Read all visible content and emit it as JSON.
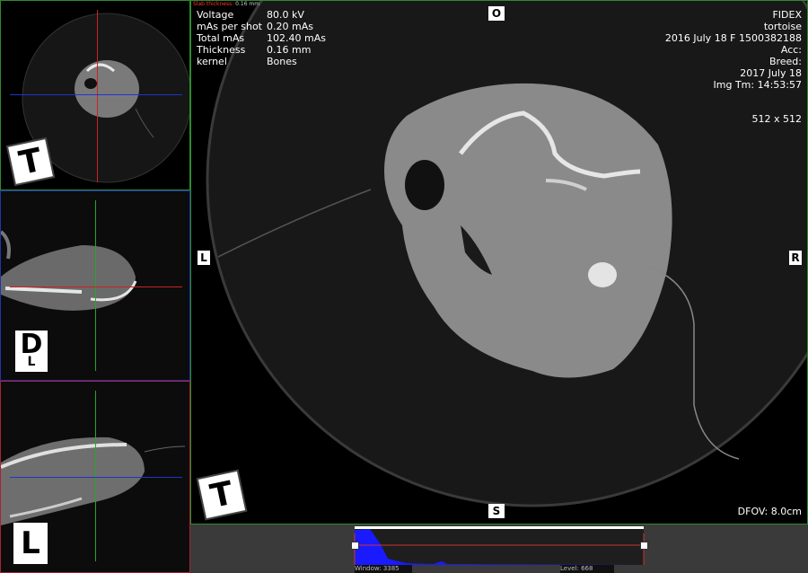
{
  "slab_label": "Slab thickness:",
  "slab_value": "0.16 mm",
  "acq": {
    "rows": [
      {
        "key": "Voltage",
        "value": "80.0 kV"
      },
      {
        "key": "mAs per shot",
        "value": "0.20 mAs"
      },
      {
        "key": "Total mAs",
        "value": "102.40 mAs"
      },
      {
        "key": "Thickness",
        "value": "0.16 mm"
      },
      {
        "key": "kernel",
        "value": "Bones"
      }
    ]
  },
  "patient": {
    "line1": "FIDEX",
    "line2": "tortoise",
    "line3": "2016 July 18   F   1500382188",
    "line4": "Acc:",
    "line5": "Breed:",
    "line6": "2017 July 18",
    "line7": "Img Tm: 14:53:57",
    "matrix": "512 x 512"
  },
  "dfov": "DFOV: 8.0cm",
  "orientation": {
    "axial_small": "T",
    "coronal": "D",
    "coronal_sub": "L",
    "sagittal": "L",
    "main": "T",
    "top_marker": "O",
    "left_marker": "L",
    "right_marker": "R",
    "bottom_marker": "S"
  },
  "histogram": {
    "window_label": "Window:",
    "window_value": "3385",
    "level_label": "Level:",
    "level_value": "668"
  },
  "colors": {
    "axial_border": "#2e8b2e",
    "coronal_border": "#2233aa",
    "sagittal_border": "#aa2233",
    "histogram_fill": "#1a1aff"
  }
}
